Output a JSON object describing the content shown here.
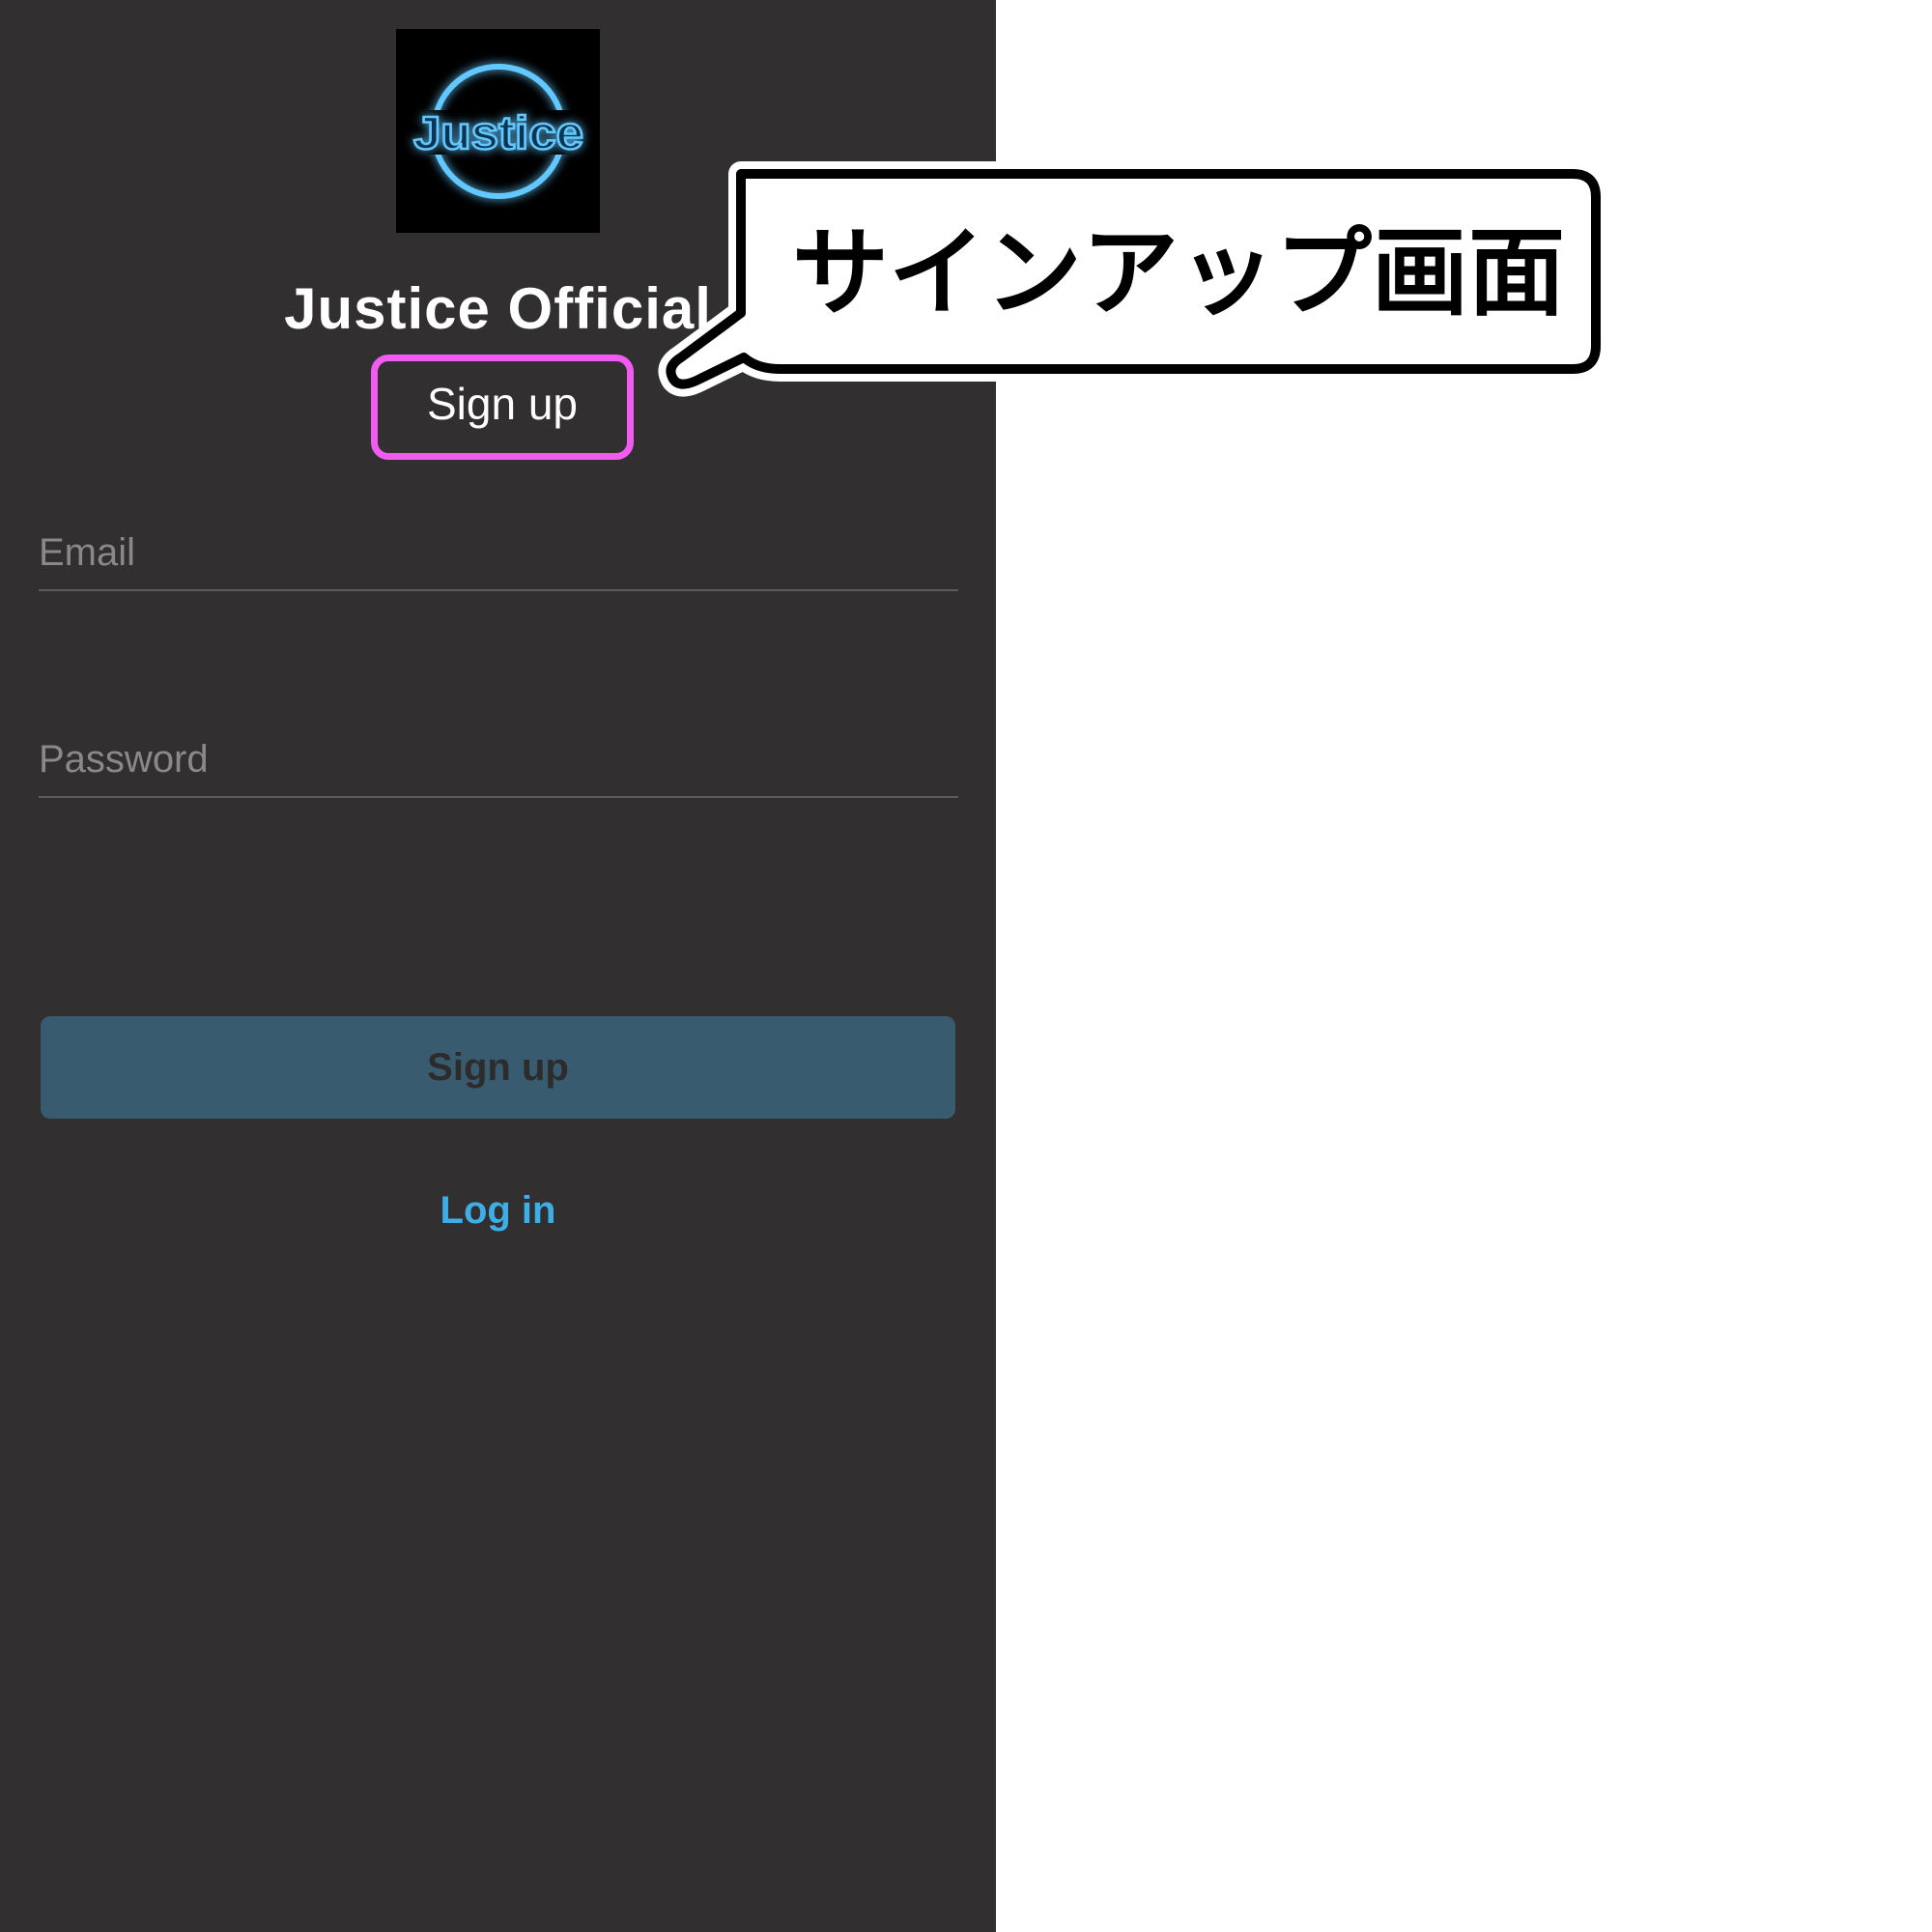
{
  "app": {
    "title": "Justice Official",
    "logo_text": "Justice",
    "logo_icon": "neon-circle-logo"
  },
  "form": {
    "heading": "Sign up",
    "email_placeholder": "Email",
    "password_placeholder": "Password",
    "submit_label": "Sign up",
    "alt_link_label": "Log in"
  },
  "annotation": {
    "callout_text": "サインアップ画面",
    "highlight_color": "#f15cf0"
  },
  "colors": {
    "screen_background": "#312f30",
    "button_background": "#395b6f",
    "link_color": "#3eafe6",
    "logo_glow": "#62c8ff"
  }
}
